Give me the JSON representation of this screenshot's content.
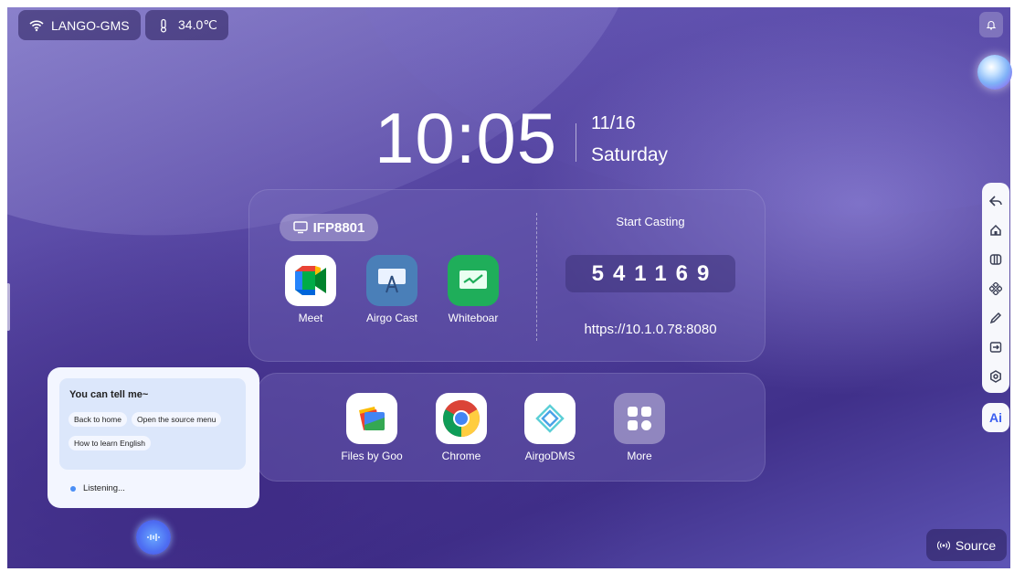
{
  "status_bar": {
    "network_name": "LANGO-GMS",
    "temperature": "34.0℃"
  },
  "clock": {
    "time": "10:05",
    "date": "11/16",
    "weekday": "Saturday"
  },
  "device": {
    "name": "IFP8801"
  },
  "primary_apps": [
    {
      "label": "Meet",
      "icon": "meet-icon"
    },
    {
      "label": "Airgo Cast",
      "icon": "airgo-cast-icon"
    },
    {
      "label": "Whiteboar",
      "icon": "whiteboard-icon"
    }
  ],
  "casting": {
    "title": "Start Casting",
    "code": "541169",
    "url": "https://10.1.0.78:8080"
  },
  "dock_apps": [
    {
      "label": "Files by Goo",
      "icon": "files-icon"
    },
    {
      "label": "Chrome",
      "icon": "chrome-icon"
    },
    {
      "label": "AirgoDMS",
      "icon": "airgodms-icon"
    },
    {
      "label": "More",
      "icon": "more-apps-icon"
    }
  ],
  "voice_assistant": {
    "title": "You can tell me~",
    "suggestions": [
      "Back to home",
      "Open the source menu",
      "How to learn English"
    ],
    "status": "Listening..."
  },
  "sidebar": {
    "items": [
      "back-icon",
      "home-icon",
      "split-screen-icon",
      "apps-icon",
      "pen-icon",
      "screen-share-icon",
      "settings-icon"
    ],
    "ai_label": "Ai"
  },
  "source_button": {
    "label": "Source"
  },
  "colors": {
    "accent_blue": "#3a5ef0",
    "meet_green": "#00ac47",
    "whiteboard_green": "#1fae5a",
    "airgo_cast_blue": "#4a7fb8"
  }
}
